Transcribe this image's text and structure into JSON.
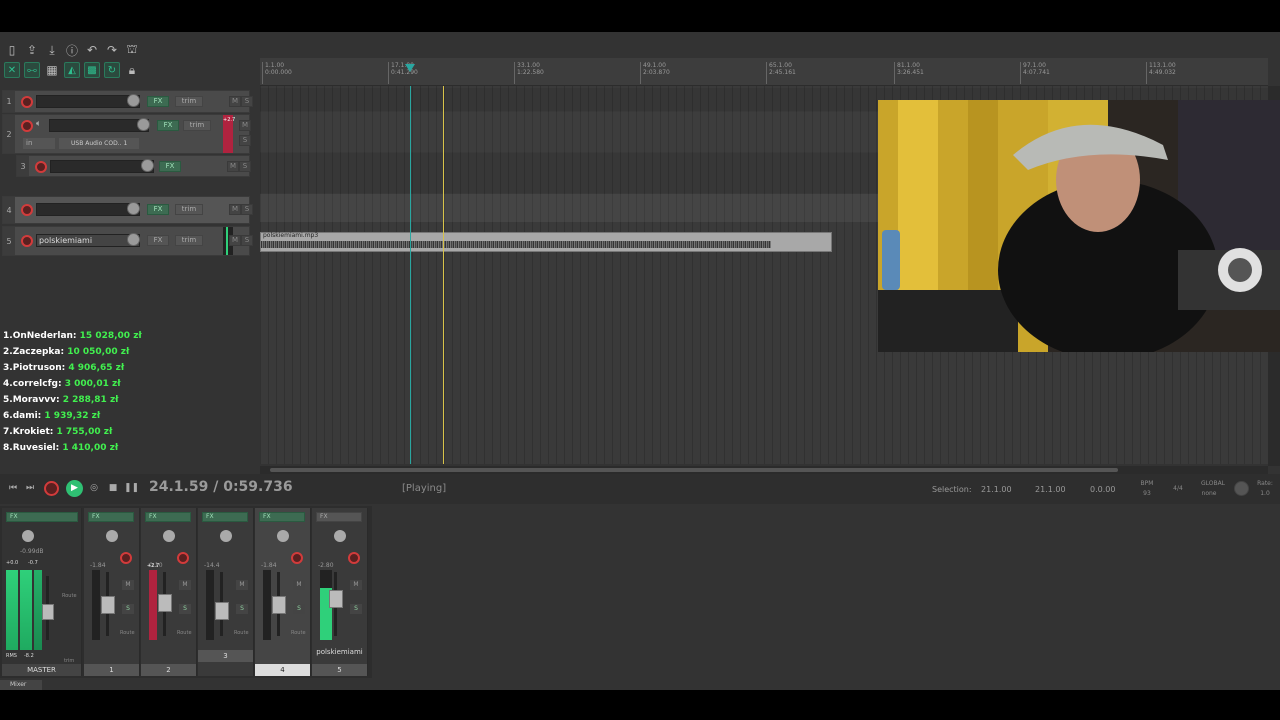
{
  "colors": {
    "accent_green": "#2fc073",
    "record_red": "#d23b3b",
    "donation_amount": "#41f04f",
    "edit_cursor": "#d8c34a",
    "play_cursor": "#2aa6a0"
  },
  "tracks": [
    {
      "num": "1",
      "name": "",
      "fx": "FX",
      "trim": "trim"
    },
    {
      "num": "2",
      "name": "",
      "fx": "FX",
      "trim": "trim",
      "meter_peak": "+2.7",
      "io": "in",
      "device": "USB Audio COD.. 1"
    },
    {
      "num": "3",
      "name": "",
      "fx": "FX"
    },
    {
      "num": "4",
      "name": "",
      "fx": "FX",
      "trim": "trim"
    },
    {
      "num": "5",
      "name": "polskiemiami",
      "fx": "FX",
      "trim": "trim"
    }
  ],
  "ms": {
    "m": "M",
    "s": "S"
  },
  "ruler": [
    {
      "bar": "1.1.00",
      "time": "0:00.000"
    },
    {
      "bar": "17.1.00",
      "time": "0:41.290"
    },
    {
      "bar": "33.1.00",
      "time": "1:22.580"
    },
    {
      "bar": "49.1.00",
      "time": "2:03.870"
    },
    {
      "bar": "65.1.00",
      "time": "2:45.161"
    },
    {
      "bar": "81.1.00",
      "time": "3:26.451"
    },
    {
      "bar": "97.1.00",
      "time": "4:07.741"
    },
    {
      "bar": "113.1.00",
      "time": "4:49.032"
    }
  ],
  "media_item": {
    "title": "polskiemiami.mp3"
  },
  "donations": [
    {
      "rank": "1.",
      "name": "OnNederlan:",
      "amount": "15 028,00 zł"
    },
    {
      "rank": "2.",
      "name": "Zaczepka:",
      "amount": "10 050,00 zł"
    },
    {
      "rank": "3.",
      "name": "Piotruson:",
      "amount": "4 906,65 zł"
    },
    {
      "rank": "4.",
      "name": "correlcfg:",
      "amount": "3 000,01 zł"
    },
    {
      "rank": "5.",
      "name": "Moravvv:",
      "amount": "2 288,81 zł"
    },
    {
      "rank": "6.",
      "name": "dami:",
      "amount": "1 939,32 zł"
    },
    {
      "rank": "7.",
      "name": "Krokiet:",
      "amount": "1 755,00 zł"
    },
    {
      "rank": "8.",
      "name": "Ruvesiel:",
      "amount": "1 410,00 zł"
    }
  ],
  "transport": {
    "time": "24.1.59 / 0:59.736",
    "status": "[Playing]",
    "selection_label": "Selection:",
    "sel_start": "21.1.00",
    "sel_end": "21.1.00",
    "sel_len": "0.0.00",
    "bpm_label": "BPM",
    "bpm": "93",
    "timesig": "4/4",
    "global_label": "GLOBAL",
    "global_value": "none",
    "rate_label": "Rate:",
    "rate": "1.0"
  },
  "mixer": {
    "master": {
      "label": "MASTER",
      "db": "-0.99dB",
      "peak_l": "+0.0",
      "peak_r": "-0.7",
      "rms": "RMS",
      "rms_val": "-8.2",
      "route": "Route",
      "trim": "trim"
    },
    "strips": [
      {
        "num": "1",
        "db": "-1.84",
        "label": ""
      },
      {
        "num": "2",
        "db": "-0.10",
        "peak": "+2.7",
        "label": ""
      },
      {
        "num": "3",
        "db": "-14.4",
        "label": ""
      },
      {
        "num": "4",
        "db": "-1.84",
        "label": ""
      },
      {
        "num": "5",
        "db": "-2.80",
        "label": "polskiemiami"
      }
    ],
    "route": "Route",
    "fx": "FX",
    "tab": "Mixer"
  }
}
